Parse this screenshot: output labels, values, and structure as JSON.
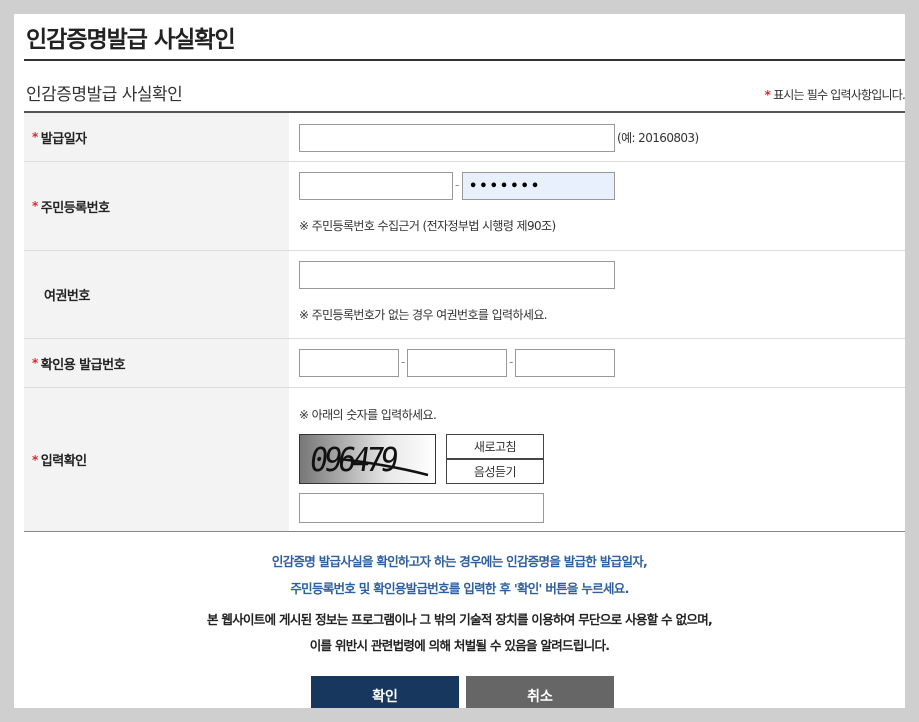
{
  "page": {
    "title": "인감증명발급 사실확인",
    "section_title": "인감증명발급 사실확인",
    "required_star": "*",
    "required_note": "표시는 필수 입력사항입니다."
  },
  "form": {
    "issue_date": {
      "label": "발급일자",
      "value": "",
      "example": "(예: 20160803)"
    },
    "resident_number": {
      "label": "주민등록번호",
      "front_value": "",
      "back_value": "•••••••",
      "separator": "-",
      "hint": "※ 주민등록번호 수집근거 (전자정부법 시행령 제90조)"
    },
    "passport_number": {
      "label": "여권번호",
      "value": "",
      "hint": "※ 주민등록번호가 없는 경우 여권번호를 입력하세요."
    },
    "confirm_issue_number": {
      "label": "확인용 발급번호",
      "parts": [
        "",
        "",
        ""
      ],
      "separator": "-"
    },
    "input_check": {
      "label": "입력확인",
      "hint": "※ 아래의 숫자를 입력하세요.",
      "captcha_text": "096479",
      "refresh_label": "새로고침",
      "audio_label": "음성듣기",
      "value": ""
    }
  },
  "notices": {
    "line1": "인감증명 발급사실을 확인하고자 하는 경우에는 인감증명을 발급한 발급일자,",
    "line2": "주민등록번호 및 확인용발급번호를 입력한 후 '확인' 버튼을 누르세요.",
    "line3": "본 웹사이트에 게시된 정보는 프로그램이나 그 밖의 기술적 장치를 이용하여 무단으로 사용할 수 없으며,",
    "line4": "이를 위반시 관련법령에 의해 처벌될 수 있음을 알려드립니다."
  },
  "buttons": {
    "confirm_label": "확인",
    "cancel_label": "취소"
  },
  "colors": {
    "accent": "#17375e",
    "required": "#d62a2a",
    "notice_blue": "#2f5f9e",
    "cancel": "#666666"
  }
}
